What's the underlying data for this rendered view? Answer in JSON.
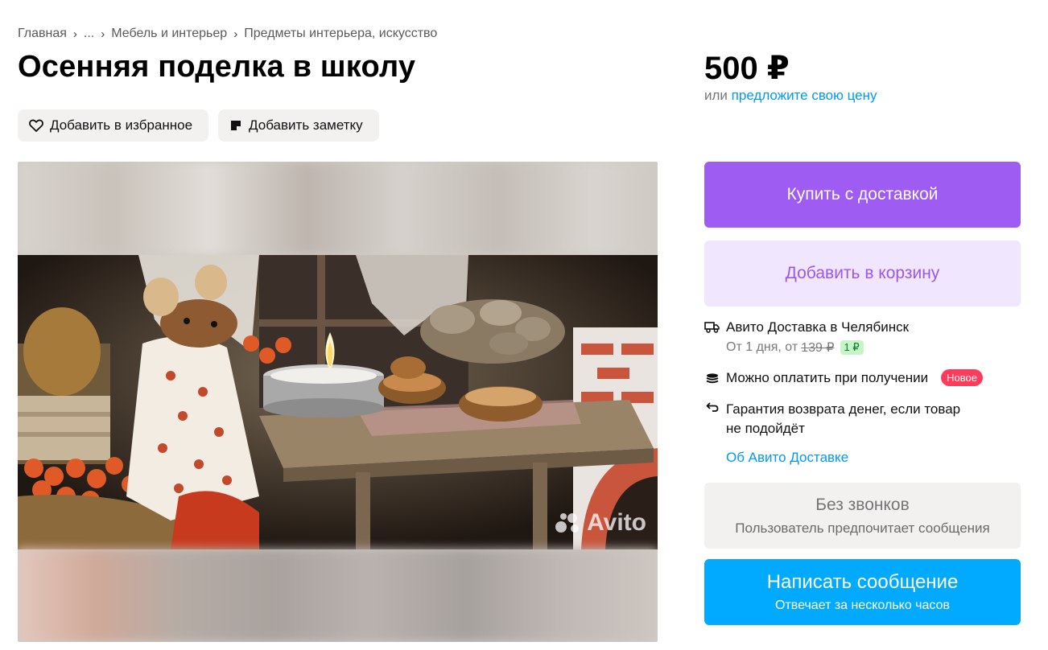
{
  "breadcrumb": {
    "items": [
      "Главная",
      "...",
      "Мебель и интерьер",
      "Предметы интерьера, искусство"
    ]
  },
  "title": "Осенняя поделка в школу",
  "actions": {
    "favorite_label": "Добавить в избранное",
    "note_label": "Добавить заметку"
  },
  "gallery": {
    "watermark": "Avito"
  },
  "price": {
    "value": "500 ₽",
    "offer_prefix": "или",
    "offer_link": "предложите свою цену"
  },
  "buttons": {
    "buy": "Купить с доставкой",
    "cart": "Добавить в корзину",
    "no_calls_title": "Без звонков",
    "no_calls_sub": "Пользователь предпочитает сообщения",
    "message_title": "Написать сообщение",
    "message_sub": "Отвечает за несколько часов"
  },
  "delivery": {
    "title": "Авито Доставка в Челябинск",
    "time_prefix": "От 1 дня, от",
    "old_price": "139 ₽",
    "new_price": "1 ₽",
    "pay_on_receipt": "Можно оплатить при получении",
    "new_badge": "Новое",
    "guarantee_line1": "Гарантия возврата денег, если товар",
    "guarantee_line2": "не подойдёт",
    "about_link": "Об Авито Доставке"
  },
  "colors": {
    "buy": "#9f5cf3",
    "cart_bg": "#f0e6fd",
    "message": "#01aaff",
    "link": "#0099f7",
    "new_badge": "#ff3b5c"
  },
  "icons": [
    "chevron-right-icon",
    "heart-icon",
    "note-icon",
    "truck-icon",
    "coins-icon",
    "return-arrow-icon",
    "avito-logo-icon"
  ]
}
